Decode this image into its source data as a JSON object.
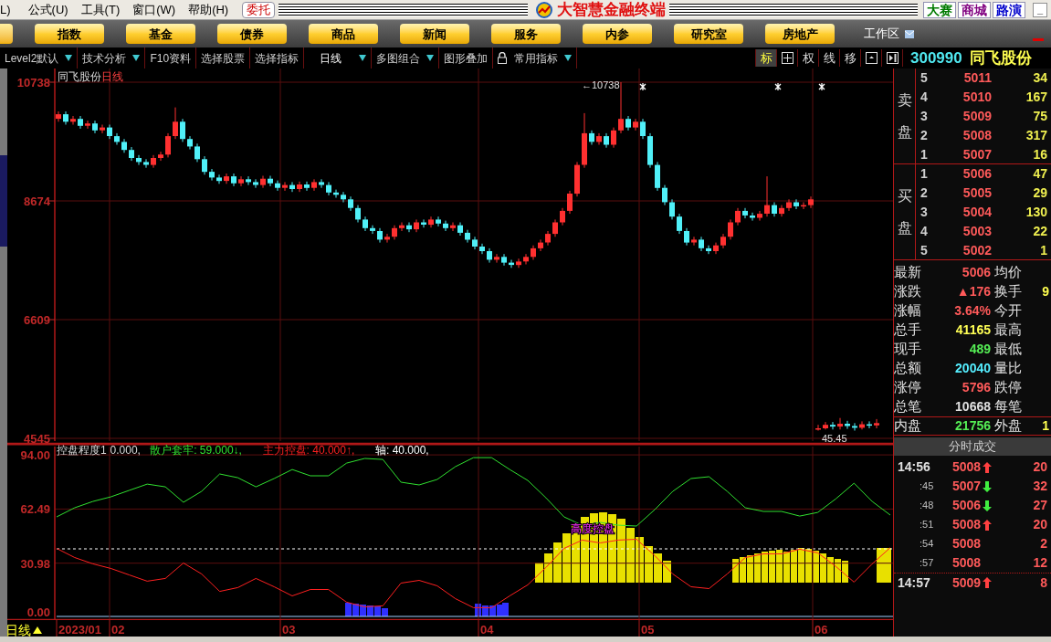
{
  "menu_bar": {
    "items": [
      "L)",
      "公式(U)",
      "工具(T)",
      "窗口(W)",
      "帮助(H)"
    ],
    "trade_button": "委托",
    "app_title": "大智慧金融终端",
    "links": [
      {
        "label": "大赛",
        "color": "#007a00"
      },
      {
        "label": "商城",
        "color": "#800080"
      },
      {
        "label": "路演",
        "color": "#0000cc"
      }
    ],
    "minimize": "_"
  },
  "nav_buttons": [
    "指数",
    "基金",
    "债券",
    "商品",
    "新闻",
    "服务",
    "内参",
    "研究室",
    "房地产"
  ],
  "workspace": "工作区",
  "toolbar": {
    "items": [
      {
        "label": "Level2默认",
        "dropdown": true,
        "lock_icon": false
      },
      {
        "label": "技术分析",
        "dropdown": true,
        "lock_icon": false
      },
      {
        "label": "F10资料",
        "dropdown": false,
        "lock_icon": false
      },
      {
        "label": "选择股票",
        "dropdown": false,
        "lock_icon": false
      },
      {
        "label": "选择指标",
        "dropdown": false,
        "lock_icon": false
      },
      {
        "label": "日线",
        "dropdown": true,
        "lock_icon": false
      },
      {
        "label": "多图组合",
        "dropdown": true,
        "lock_icon": false
      },
      {
        "label": "图形叠加",
        "dropdown": false,
        "lock_icon": false
      },
      {
        "label": "常用指标",
        "dropdown": true,
        "lock_icon": true
      }
    ],
    "tools": [
      {
        "kind": "text",
        "label": "标",
        "selected": true
      },
      {
        "kind": "grid",
        "selected": false
      },
      {
        "kind": "text",
        "label": "权",
        "selected": false
      },
      {
        "kind": "text",
        "label": "线",
        "selected": false
      },
      {
        "kind": "text",
        "label": "移",
        "selected": false
      },
      {
        "kind": "panel",
        "selected": false
      },
      {
        "kind": "sidebar",
        "selected": false
      }
    ]
  },
  "stock": {
    "code": "300990",
    "name": "同飞股份"
  },
  "price_chart": {
    "title": "同飞股份",
    "period": "日线",
    "high_marker": "←10738",
    "low_marker": "45.45",
    "chart_data": {
      "type": "candlestick",
      "ylim": [
        4450,
        10976
      ],
      "yticks": [
        {
          "value": 10738,
          "label": "10738"
        },
        {
          "value": 8674,
          "label": "8674"
        },
        {
          "value": 6609,
          "label": "6609"
        },
        {
          "value": 4545,
          "label": "4545"
        }
      ],
      "categories": [
        null,
        null,
        null,
        null,
        null,
        null,
        null,
        null,
        null,
        null,
        null,
        null,
        null,
        null,
        null,
        null,
        null,
        null,
        null,
        null,
        null,
        null,
        null,
        null,
        null,
        null,
        null,
        null,
        null,
        null,
        null,
        null,
        null,
        null,
        null,
        null,
        null,
        null,
        null,
        null,
        null,
        null,
        null,
        null,
        null,
        null,
        null,
        null,
        null,
        null,
        null,
        null,
        null,
        null,
        null,
        null,
        null,
        null,
        null,
        null,
        null,
        null,
        null,
        null,
        null,
        null,
        null,
        null,
        null,
        null,
        null,
        null,
        null,
        null,
        null,
        null,
        null,
        null,
        null,
        null,
        null,
        null,
        null,
        null,
        null,
        null,
        null,
        null,
        null,
        null,
        null,
        null,
        null,
        null,
        null,
        null,
        null,
        null,
        null,
        null,
        null,
        null,
        null,
        null,
        null,
        null,
        null,
        null,
        null,
        null,
        null,
        null,
        null
      ],
      "grid": true,
      "ohlc": [
        [
          10100,
          10230,
          10050,
          10180
        ],
        [
          10180,
          10230,
          10000,
          10050
        ],
        [
          10050,
          10150,
          10000,
          10100
        ],
        [
          10100,
          10150,
          9930,
          9980
        ],
        [
          9980,
          10070,
          9930,
          10020
        ],
        [
          10020,
          10070,
          9850,
          9900
        ],
        [
          9900,
          10000,
          9850,
          9950
        ],
        [
          9950,
          10000,
          9750,
          9800
        ],
        [
          9800,
          9850,
          9650,
          9700
        ],
        [
          9700,
          9750,
          9510,
          9560
        ],
        [
          9560,
          9610,
          9370,
          9420
        ],
        [
          9420,
          9470,
          9300,
          9350
        ],
        [
          9350,
          9400,
          9250,
          9300
        ],
        [
          9300,
          9470,
          9250,
          9420
        ],
        [
          9420,
          9530,
          9370,
          9480
        ],
        [
          9480,
          9850,
          9430,
          9800
        ],
        [
          9800,
          10300,
          9750,
          10050
        ],
        [
          10050,
          10100,
          9700,
          9750
        ],
        [
          9750,
          9800,
          9570,
          9620
        ],
        [
          9620,
          9670,
          9350,
          9400
        ],
        [
          9400,
          9450,
          9130,
          9180
        ],
        [
          9180,
          9230,
          9030,
          9080
        ],
        [
          9080,
          9130,
          8970,
          9020
        ],
        [
          9020,
          9150,
          8970,
          9100
        ],
        [
          9100,
          9150,
          8930,
          8980
        ],
        [
          8980,
          9100,
          8930,
          9050
        ],
        [
          9050,
          9100,
          8950,
          9000
        ],
        [
          9000,
          9050,
          8900,
          8950
        ],
        [
          8950,
          9110,
          8900,
          9060
        ],
        [
          9060,
          9110,
          8930,
          8980
        ],
        [
          8980,
          9030,
          8850,
          8900
        ],
        [
          8900,
          9000,
          8850,
          8950
        ],
        [
          8950,
          9000,
          8830,
          8880
        ],
        [
          8880,
          9010,
          8830,
          8960
        ],
        [
          8960,
          9010,
          8850,
          8900
        ],
        [
          8900,
          9050,
          8850,
          9000
        ],
        [
          9000,
          9050,
          8900,
          8950
        ],
        [
          8950,
          9000,
          8770,
          8820
        ],
        [
          8820,
          8870,
          8730,
          8780
        ],
        [
          8780,
          8830,
          8650,
          8700
        ],
        [
          8700,
          8750,
          8500,
          8550
        ],
        [
          8550,
          8600,
          8300,
          8350
        ],
        [
          8350,
          8400,
          8150,
          8200
        ],
        [
          8200,
          8250,
          8100,
          8150
        ],
        [
          8150,
          8200,
          7950,
          8000
        ],
        [
          8000,
          8100,
          7950,
          8050
        ],
        [
          8050,
          8250,
          8000,
          8200
        ],
        [
          8200,
          8300,
          8150,
          8250
        ],
        [
          8250,
          8300,
          8130,
          8180
        ],
        [
          8180,
          8350,
          8130,
          8300
        ],
        [
          8300,
          8350,
          8210,
          8260
        ],
        [
          8260,
          8400,
          8210,
          8350
        ],
        [
          8350,
          8400,
          8230,
          8280
        ],
        [
          8280,
          8330,
          8150,
          8200
        ],
        [
          8200,
          8300,
          8150,
          8250
        ],
        [
          8250,
          8300,
          8070,
          8120
        ],
        [
          8120,
          8170,
          7950,
          8000
        ],
        [
          8000,
          8050,
          7830,
          7880
        ],
        [
          7880,
          7930,
          7750,
          7800
        ],
        [
          7800,
          7850,
          7600,
          7650
        ],
        [
          7650,
          7750,
          7600,
          7700
        ],
        [
          7700,
          7750,
          7550,
          7600
        ],
        [
          7600,
          7650,
          7510,
          7560
        ],
        [
          7560,
          7670,
          7510,
          7620
        ],
        [
          7620,
          7750,
          7570,
          7700
        ],
        [
          7700,
          7900,
          7650,
          7850
        ],
        [
          7850,
          8000,
          7800,
          7950
        ],
        [
          7950,
          8150,
          7900,
          8100
        ],
        [
          8100,
          8350,
          8050,
          8300
        ],
        [
          8300,
          8550,
          8250,
          8500
        ],
        [
          8500,
          8850,
          8450,
          8800
        ],
        [
          8800,
          9350,
          8750,
          9300
        ],
        [
          9300,
          10200,
          9250,
          9850
        ],
        [
          9850,
          9900,
          9650,
          9700
        ],
        [
          9700,
          9850,
          9650,
          9800
        ],
        [
          9800,
          9850,
          9600,
          9650
        ],
        [
          9650,
          9950,
          9600,
          9900
        ],
        [
          9900,
          10738,
          9850,
          10100
        ],
        [
          10100,
          10150,
          9900,
          9950
        ],
        [
          9950,
          10100,
          9900,
          10050
        ],
        [
          10050,
          10100,
          9750,
          9800
        ],
        [
          9800,
          9850,
          9250,
          9300
        ],
        [
          9300,
          9350,
          8850,
          8900
        ],
        [
          8900,
          8950,
          8600,
          8650
        ],
        [
          8650,
          8700,
          8350,
          8400
        ],
        [
          8400,
          8450,
          8100,
          8150
        ],
        [
          8150,
          8200,
          7900,
          7950
        ],
        [
          7950,
          8050,
          7900,
          8000
        ],
        [
          8000,
          8050,
          7800,
          7850
        ],
        [
          7850,
          7900,
          7750,
          7800
        ],
        [
          7800,
          7950,
          7750,
          7900
        ],
        [
          7900,
          8100,
          7850,
          8050
        ],
        [
          8050,
          8350,
          8000,
          8300
        ],
        [
          8300,
          8550,
          8250,
          8500
        ],
        [
          8500,
          8550,
          8370,
          8420
        ],
        [
          8420,
          8470,
          8330,
          8380
        ],
        [
          8380,
          8500,
          8330,
          8450
        ],
        [
          8450,
          9100,
          8400,
          8600
        ],
        [
          8600,
          8650,
          8400,
          8450
        ],
        [
          8450,
          8600,
          8400,
          8550
        ],
        [
          8550,
          8700,
          8500,
          8650
        ],
        [
          8650,
          8700,
          8530,
          8580
        ],
        [
          8580,
          8650,
          8530,
          8600
        ],
        [
          8600,
          8750,
          8550,
          8700
        ],
        [
          4700,
          4780,
          4680,
          4720
        ],
        [
          4720,
          4830,
          4700,
          4780
        ],
        [
          4780,
          4830,
          4700,
          4750
        ],
        [
          4750,
          4900,
          4700,
          4800
        ],
        [
          4800,
          4850,
          4710,
          4760
        ],
        [
          4760,
          4810,
          4680,
          4730
        ],
        [
          4730,
          4840,
          4700,
          4790
        ],
        [
          4790,
          4840,
          4720,
          4770
        ],
        [
          4770,
          4880,
          4720,
          4810
        ]
      ]
    }
  },
  "indicator": {
    "legend": [
      {
        "kind": "text",
        "text": "控盘程度1"
      },
      {
        "kind": "text",
        "text": "0.000,"
      },
      {
        "kind": "series",
        "text": ": 59.000↓,"
      },
      {
        "kind": "series",
        "text": ": 40.000↑,"
      },
      {
        "kind": "text",
        "text": "轴: 40.000,"
      }
    ],
    "bar_label": "高度控盘",
    "chart_data": {
      "type": "line",
      "ylim": [
        -2.1,
        100.4
      ],
      "grid": true,
      "yticks": [
        {
          "value": 94,
          "label": "94.00"
        },
        {
          "value": 62.49,
          "label": "62.49"
        },
        {
          "value": 30.98,
          "label": "30.98"
        },
        {
          "value": 0,
          "label": "0.00"
        }
      ],
      "series": [
        {
          "name": "散户套牢",
          "color": "#30e030",
          "values": [
            57.9,
            63.2,
            66.9,
            69.6,
            73.3,
            77.0,
            75.4,
            66.4,
            72.8,
            82.9,
            80.7,
            75.4,
            80.2,
            85.5,
            81.8,
            81.8,
            89.2,
            91.9,
            91.3,
            78.1,
            76.5,
            79.7,
            87.1,
            92.4,
            92.4,
            85.5,
            79.1,
            69.0,
            57.9,
            53.1,
            54.7,
            53.1,
            52.6,
            62.1,
            72.8,
            80.2,
            81.3,
            72.8,
            63.2,
            61.1,
            61.1,
            58.4,
            60.5,
            68.5,
            77.5,
            66.9,
            59.0
          ]
        },
        {
          "name": "主力控盘",
          "color": "#ff2020",
          "values": [
            39.6,
            34.3,
            30.6,
            27.9,
            24.2,
            20.5,
            22.1,
            31.1,
            24.7,
            14.6,
            16.8,
            22.1,
            17.3,
            12.0,
            15.7,
            15.7,
            8.3,
            5.6,
            6.2,
            19.4,
            21.0,
            17.8,
            10.4,
            5.1,
            5.1,
            12.0,
            18.4,
            28.5,
            39.6,
            44.4,
            42.8,
            44.4,
            44.9,
            35.4,
            24.7,
            17.3,
            16.2,
            24.7,
            34.3,
            36.4,
            36.4,
            39.1,
            37.0,
            29.0,
            20.0,
            30.6,
            40.0
          ]
        }
      ]
    }
  },
  "date_axis": {
    "period": "日线",
    "labels": [
      "2023/01",
      "02",
      "03",
      "04",
      "05",
      "06"
    ]
  },
  "order_book": {
    "sell_label": "卖盘",
    "buy_label": "买盘",
    "asks": [
      {
        "rank": "5",
        "price": "5011",
        "volume": "34"
      },
      {
        "rank": "4",
        "price": "5010",
        "volume": "167"
      },
      {
        "rank": "3",
        "price": "5009",
        "volume": "75"
      },
      {
        "rank": "2",
        "price": "5008",
        "volume": "317"
      },
      {
        "rank": "1",
        "price": "5007",
        "volume": "16"
      }
    ],
    "bids": [
      {
        "rank": "1",
        "price": "5006",
        "volume": "47"
      },
      {
        "rank": "2",
        "price": "5005",
        "volume": "29"
      },
      {
        "rank": "3",
        "price": "5004",
        "volume": "130"
      },
      {
        "rank": "4",
        "price": "5003",
        "volume": "22"
      },
      {
        "rank": "5",
        "price": "5002",
        "volume": "1"
      }
    ]
  },
  "stats": [
    {
      "label": "最新",
      "value": "5006",
      "color": "#ff5a5a",
      "label2": "均价"
    },
    {
      "label": "涨跌",
      "value": "▲176",
      "color": "#ff5a5a",
      "label2": "换手",
      "value2": "9"
    },
    {
      "label": "涨幅",
      "value": "3.64%",
      "color": "#ff5a5a",
      "label2": "今开"
    },
    {
      "label": "总手",
      "value": "41165",
      "color": "#ffff55",
      "label2": "最高"
    },
    {
      "label": "现手",
      "value": "489",
      "color": "#55ee55",
      "label2": "最低"
    },
    {
      "label": "总额",
      "value": "20040",
      "color": "#55eeff",
      "label2": "量比"
    },
    {
      "label": "涨停",
      "value": "5796",
      "color": "#ff5a5a",
      "label2": "跌停"
    },
    {
      "label": "总笔",
      "value": "10668",
      "color": "#e0e0e0",
      "label2": "每笔"
    },
    {
      "label": "内盘",
      "value": "21756",
      "color": "#55ee55",
      "label2": "外盘",
      "value2": "1"
    }
  ],
  "trades_header": "分时成交",
  "trades": [
    {
      "time": "14:56",
      "price": "5008",
      "kind": "up",
      "volume": "20"
    },
    {
      "time": ":45",
      "price": "5007",
      "kind": "down",
      "volume": "32"
    },
    {
      "time": ":48",
      "price": "5006",
      "kind": "down",
      "volume": "27"
    },
    {
      "time": ":51",
      "price": "5008",
      "kind": "up",
      "volume": "20"
    },
    {
      "time": ":54",
      "price": "5008",
      "kind": "flat",
      "volume": "2"
    },
    {
      "time": ":57",
      "price": "5008",
      "kind": "flat",
      "volume": "12"
    },
    {
      "time": "14:57",
      "price": "5009",
      "kind": "up",
      "volume": "8"
    }
  ]
}
